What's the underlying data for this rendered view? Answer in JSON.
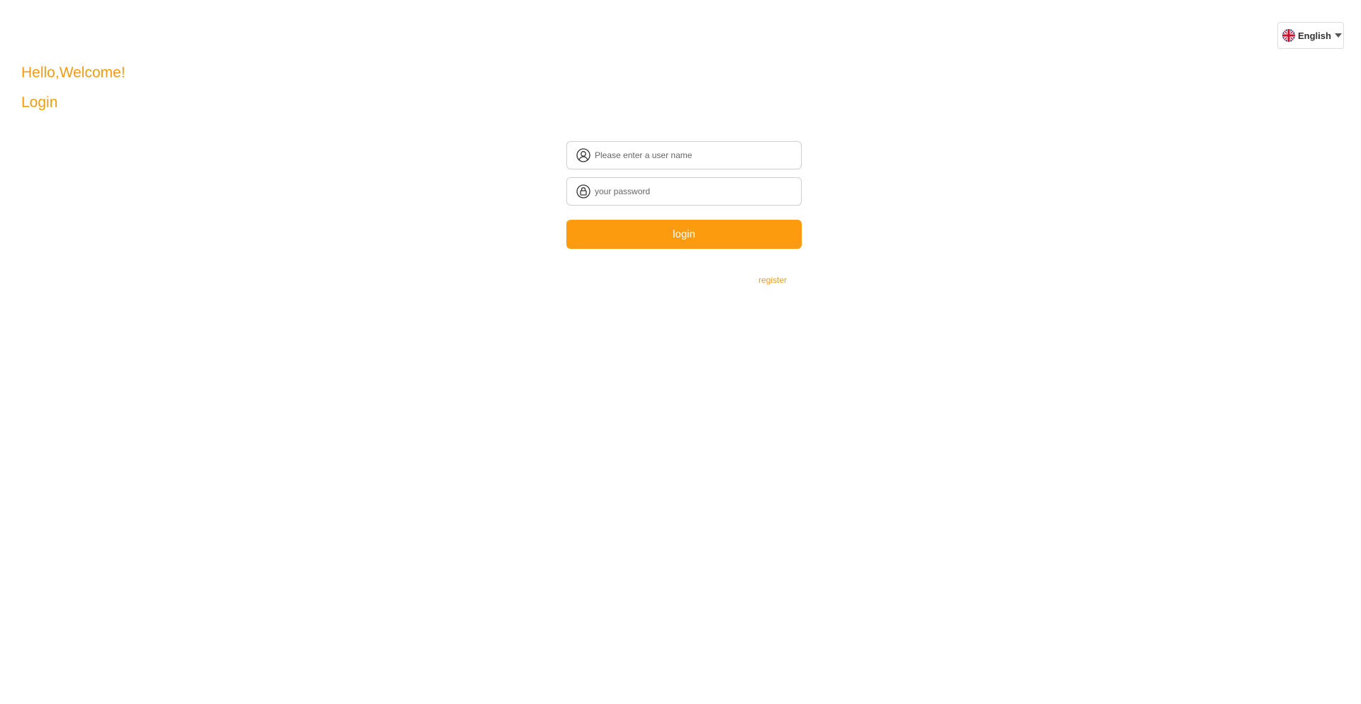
{
  "language_selector": {
    "label": "English",
    "flag_icon": "uk-flag-icon",
    "caret_icon": "caret-down-icon"
  },
  "header": {
    "greeting": "Hello,Welcome!",
    "title": "Login"
  },
  "form": {
    "username": {
      "placeholder": "Please enter a user name",
      "value": "",
      "icon": "user-icon"
    },
    "password": {
      "placeholder": "your password",
      "value": "",
      "icon": "lock-icon"
    },
    "login_label": "login",
    "register_label": "register"
  },
  "colors": {
    "accent": "#f39c12",
    "button": "#fc9b0d",
    "background": "#ffffff"
  }
}
